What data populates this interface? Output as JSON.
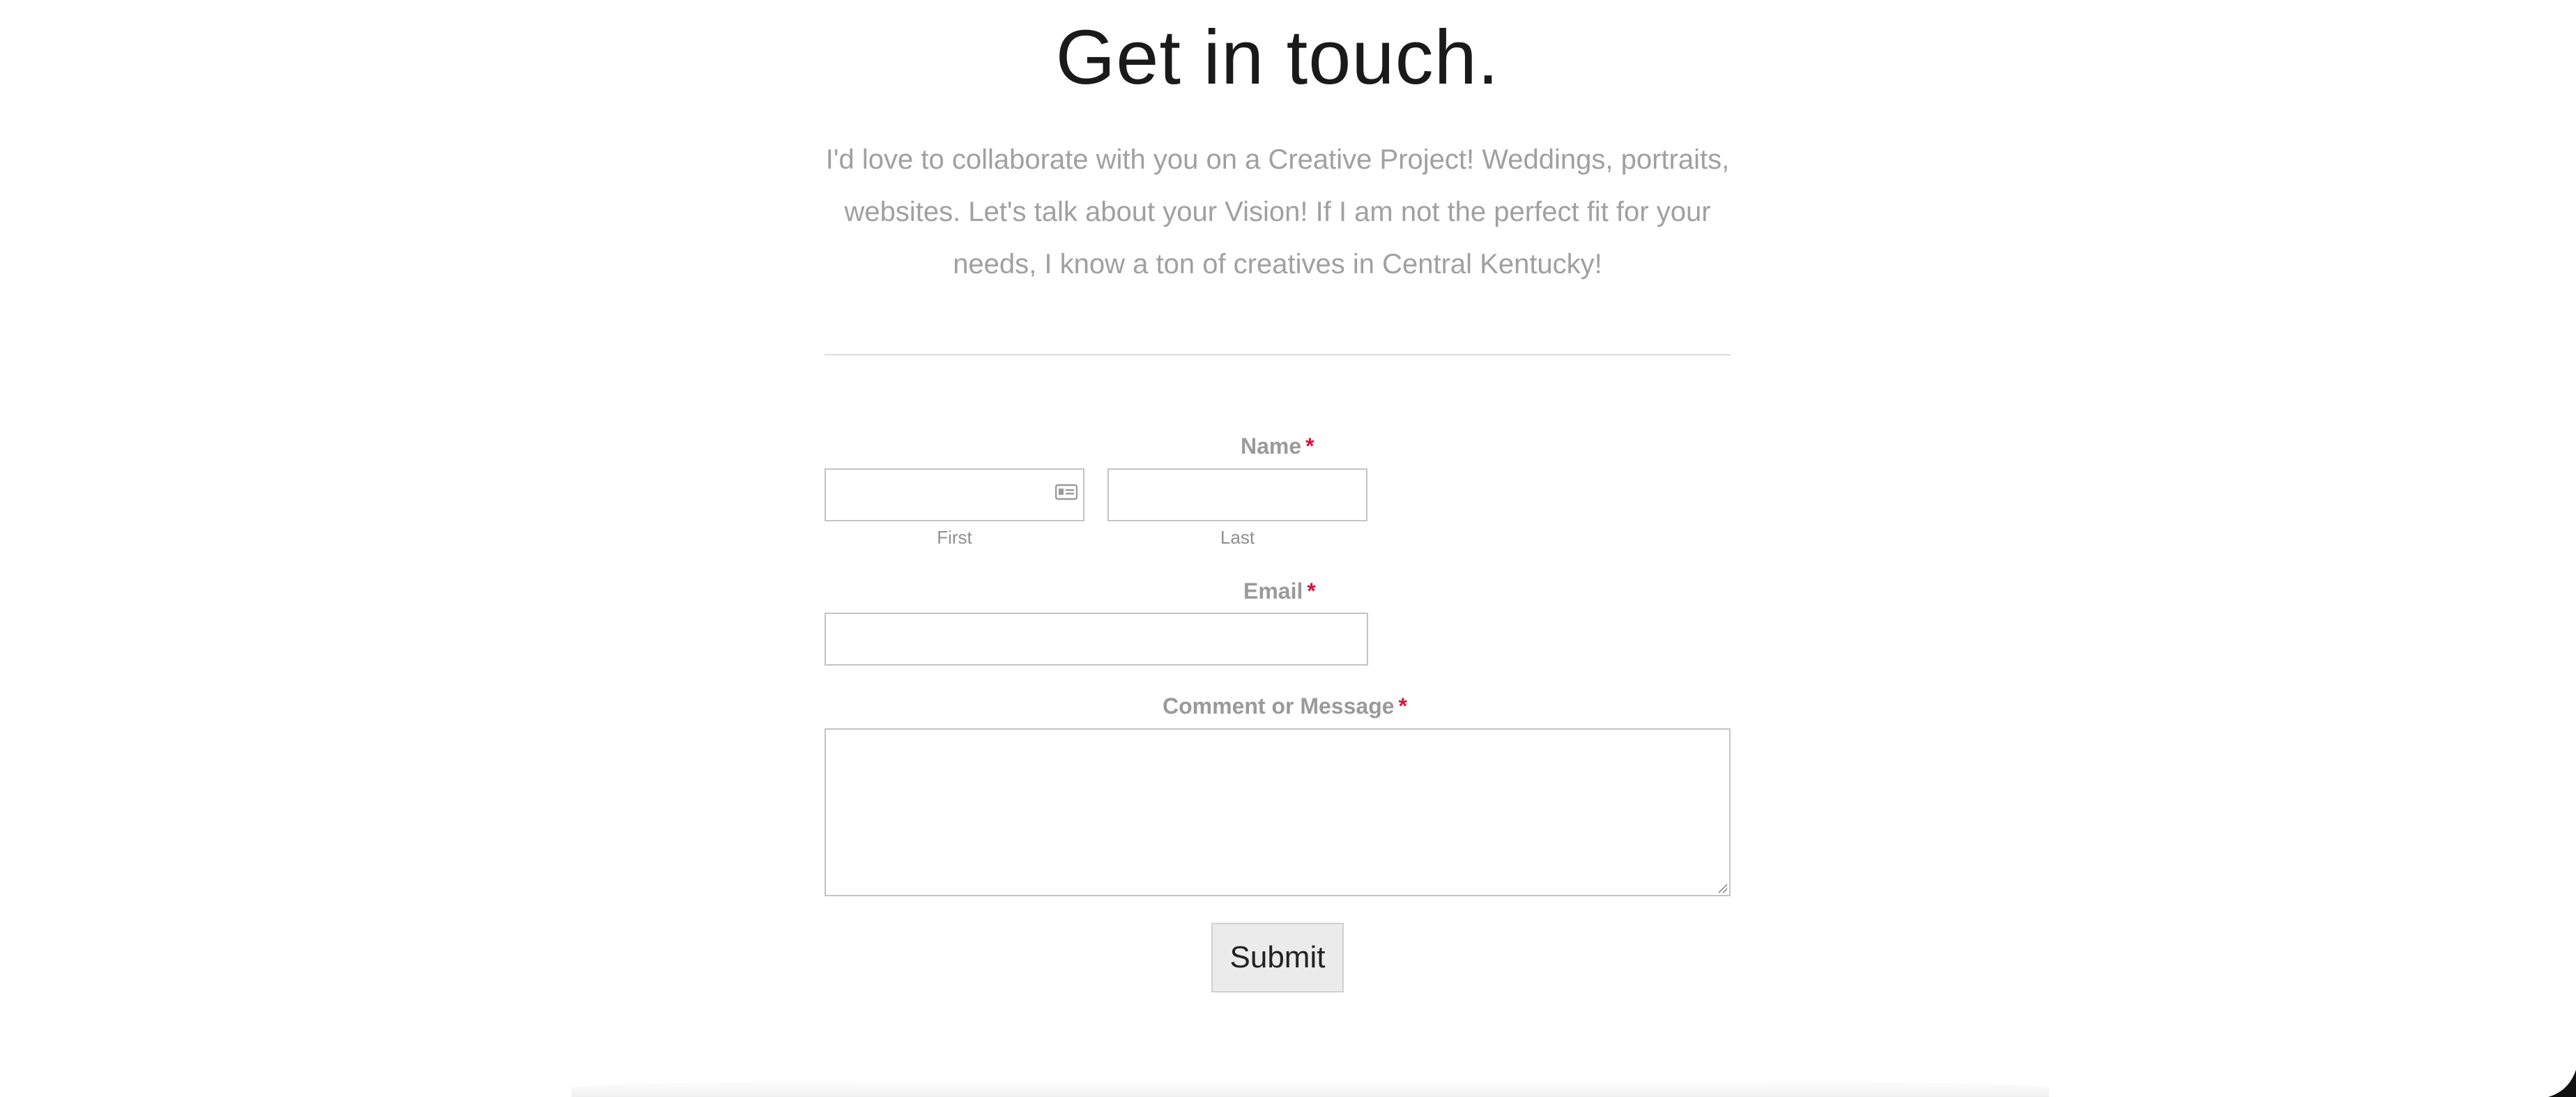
{
  "heading": {
    "title": "Get in touch.",
    "intro": "I'd love to collaborate with you on a Creative Project! Weddings, portraits, websites. Let's talk about your Vision! If I am not the perfect fit for your needs, I know a ton of creatives in Central Kentucky!"
  },
  "form": {
    "name": {
      "label": "Name",
      "required_mark": "*",
      "first_sublabel": "First",
      "last_sublabel": "Last",
      "first_value": "",
      "last_value": ""
    },
    "email": {
      "label": "Email",
      "required_mark": "*",
      "value": ""
    },
    "message": {
      "label": "Comment or Message",
      "required_mark": "*",
      "value": ""
    },
    "submit_label": "Submit"
  },
  "colors": {
    "required": "#d8143a",
    "title": "#1a1a1a",
    "muted_text": "#a0a0a0",
    "button_bg": "#ebebeb"
  },
  "icons": {
    "autofill": "contact-card-icon",
    "resize": "resize-handle-icon"
  }
}
